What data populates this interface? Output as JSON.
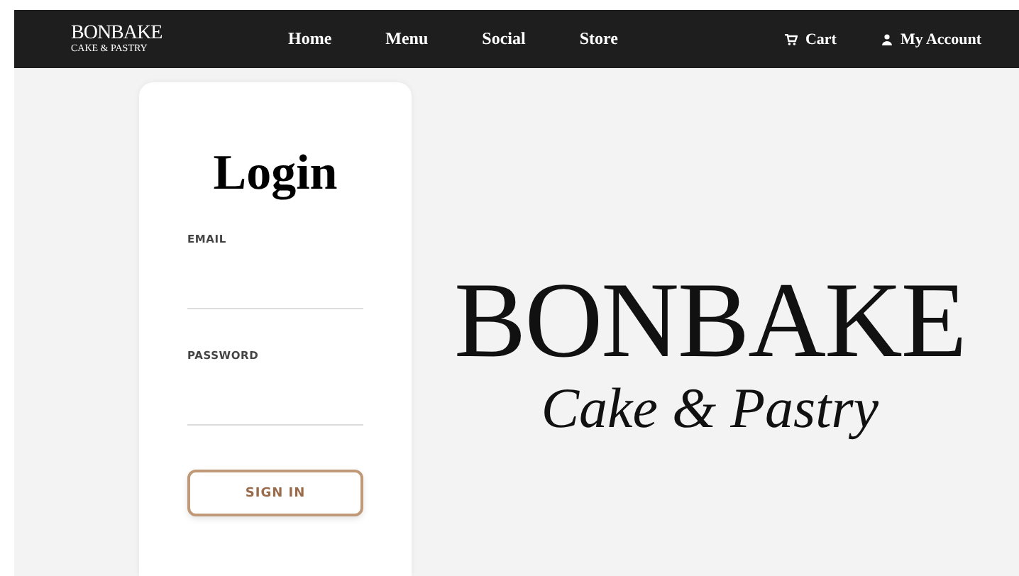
{
  "nav": {
    "logo": {
      "name": "BONBAKE",
      "tagline": "CAKE & PASTRY"
    },
    "links": [
      {
        "label": "Home"
      },
      {
        "label": "Menu"
      },
      {
        "label": "Social"
      },
      {
        "label": "Store"
      }
    ],
    "cart": "Cart",
    "account": "My Account"
  },
  "login": {
    "title": "Login",
    "fields": [
      {
        "label": "EMAIL"
      },
      {
        "label": "PASSWORD"
      }
    ],
    "button": "SIGN IN"
  },
  "hero": {
    "name": "BONBAKE",
    "tagline": "Cake & Pastry"
  }
}
